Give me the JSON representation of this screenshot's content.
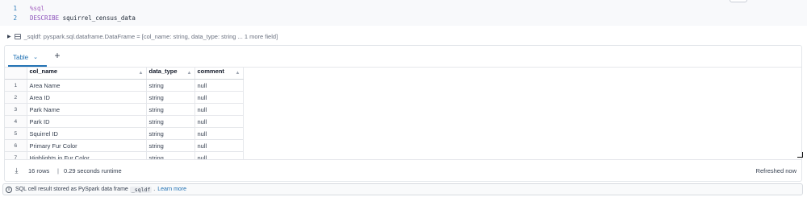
{
  "code": {
    "lines": [
      {
        "num": "1",
        "text": "%sql"
      },
      {
        "num": "2",
        "keyword": "DESCRIBE",
        "ident": "squirrel_census_data"
      }
    ]
  },
  "dataframe": {
    "text": "_sqldf:  pyspark.sql.dataframe.DataFrame = [col_name: string, data_type: string ... 1 more field]"
  },
  "tabs": [
    {
      "label": "Table",
      "icon": "chevron-down-icon"
    }
  ],
  "add_tab_icon": "plus-icon",
  "table": {
    "columns": [
      "col_name",
      "data_type",
      "comment"
    ],
    "rows": [
      {
        "idx": "1",
        "col_name": "Area Name",
        "data_type": "string",
        "comment": "null"
      },
      {
        "idx": "2",
        "col_name": "Area ID",
        "data_type": "string",
        "comment": "null"
      },
      {
        "idx": "3",
        "col_name": "Park Name",
        "data_type": "string",
        "comment": "null"
      },
      {
        "idx": "4",
        "col_name": "Park ID",
        "data_type": "string",
        "comment": "null"
      },
      {
        "idx": "5",
        "col_name": "Squirrel ID",
        "data_type": "string",
        "comment": "null"
      },
      {
        "idx": "6",
        "col_name": "Primary Fur Color",
        "data_type": "string",
        "comment": "null"
      },
      {
        "idx": "7",
        "col_name": "Highlights in Fur Color",
        "data_type": "string",
        "comment": "null"
      }
    ]
  },
  "footer": {
    "row_count": "16 rows",
    "separator": "|",
    "runtime": "0.29 seconds runtime",
    "refreshed": "Refreshed now"
  },
  "info": {
    "text_before": "SQL cell result stored as PySpark data frame",
    "code": "_sqldf",
    "text_after": ".",
    "link": "Learn more"
  },
  "colors": {
    "accent": "#2272b4",
    "line_numbers": "#2b7bb9",
    "sql_keyword": "#8a4fba"
  }
}
